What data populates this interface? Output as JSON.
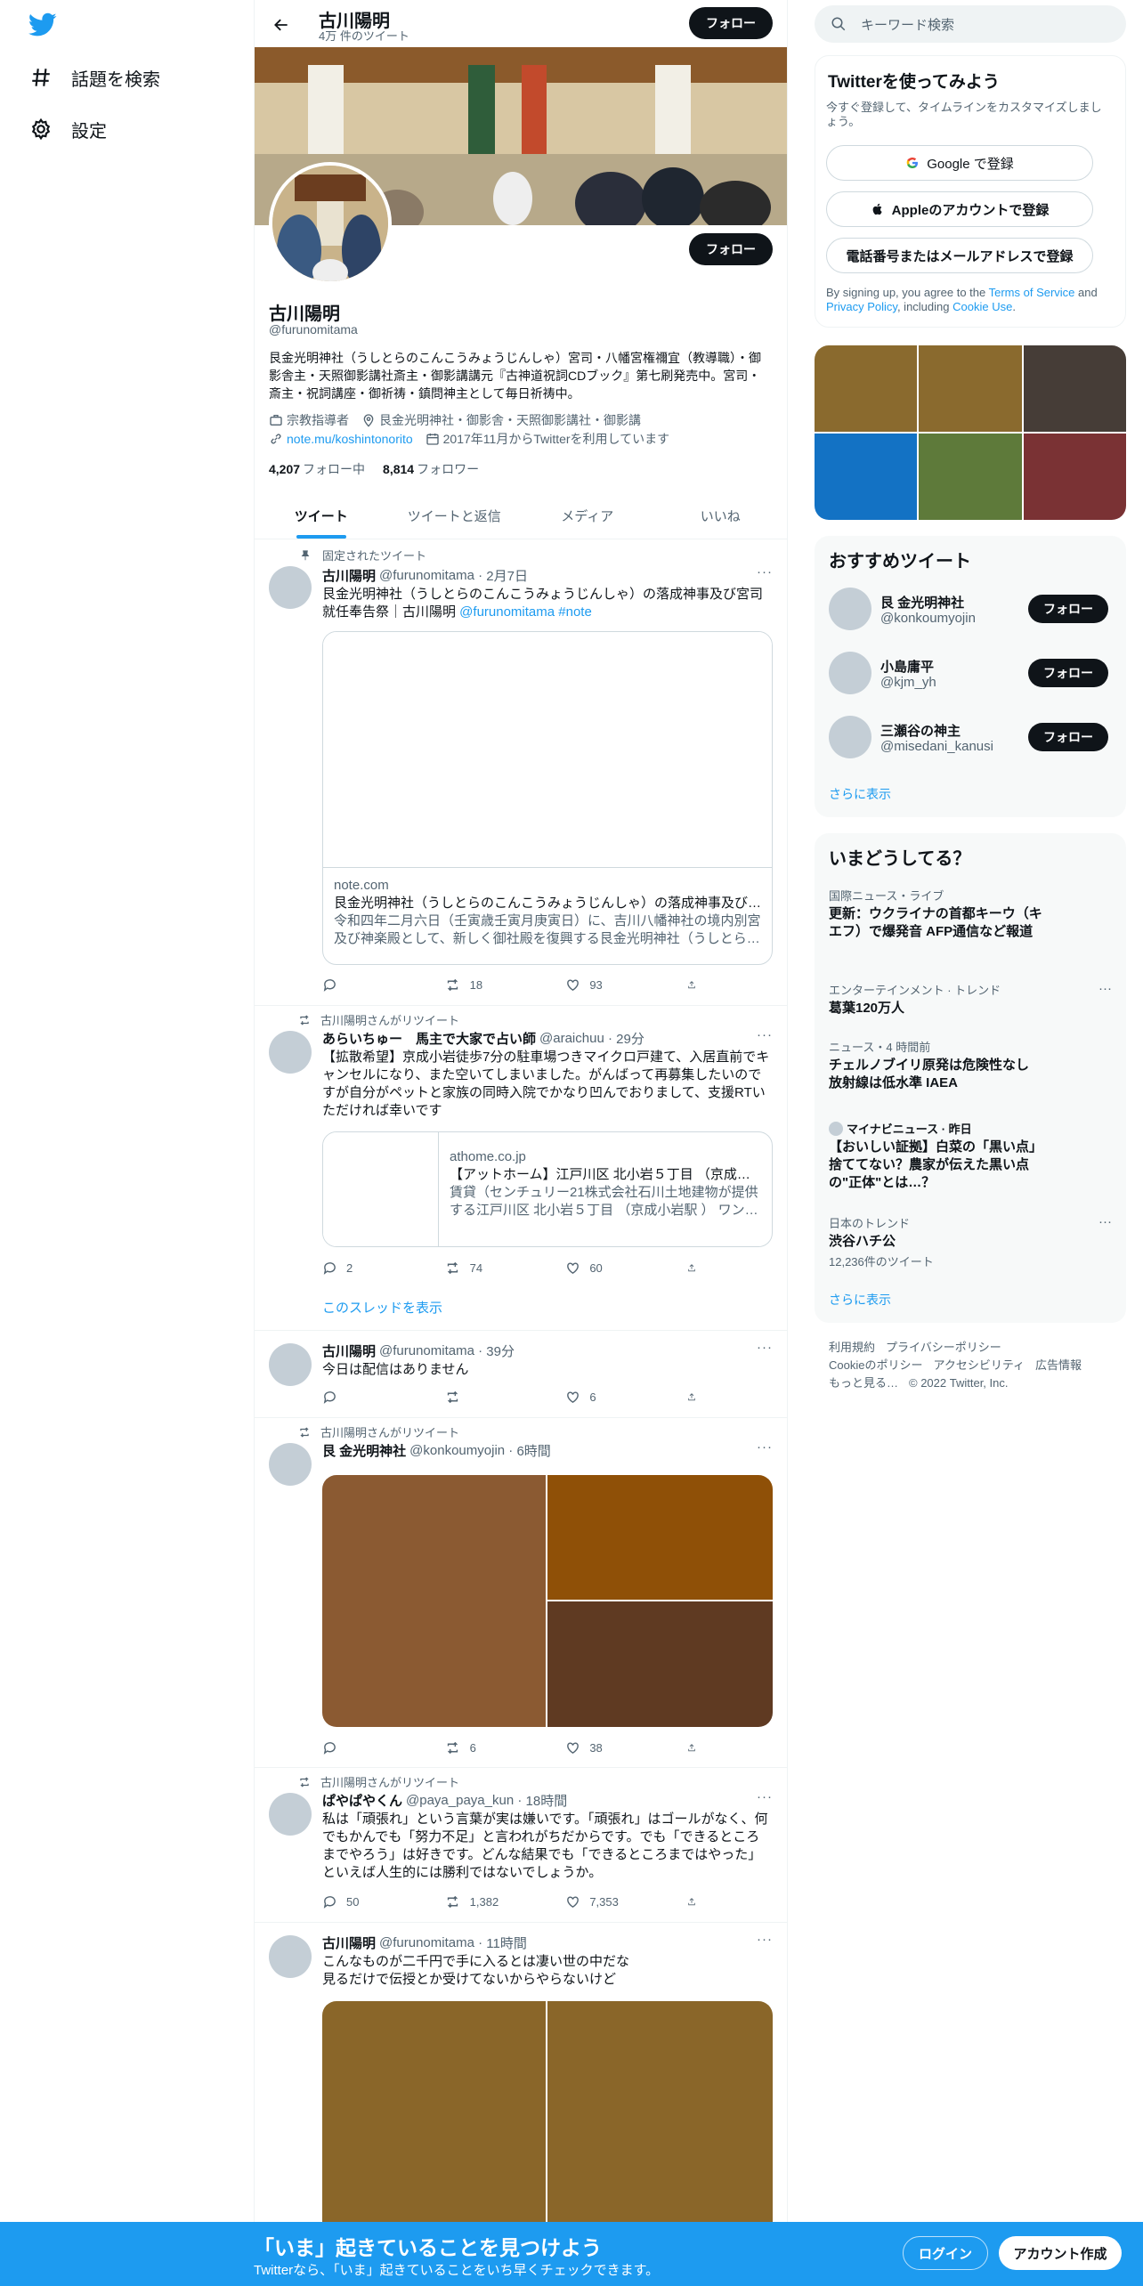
{
  "nav": {
    "items": [
      {
        "label": "話題を検索",
        "icon": "hashtag-icon"
      },
      {
        "label": "設定",
        "icon": "gear-icon"
      }
    ]
  },
  "header": {
    "name": "古川陽明",
    "tweet_count": "4万 件のツイート",
    "follow_label": "フォロー"
  },
  "profile": {
    "name": "古川陽明",
    "handle": "@furunomitama",
    "follow_label": "フォロー",
    "bio": "艮金光明神社（うしとらのこんこうみょうじんしゃ）宮司・八幡宮権禰宜（教導職）・御影舎主・天照御影講社斎主・御影講講元『古神道祝詞CDブック』第七刷発売中。宮司・斎主・祝詞講座・御祈祷・鎮問神主として毎日祈祷中。",
    "category": "宗教指導者",
    "location": "艮金光明神社・御影舎・天照御影講社・御影講",
    "website": "note.mu/koshintonorito",
    "joined": "2017年11月からTwitterを利用しています",
    "following_count": "4,207",
    "following_label": "フォロー中",
    "followers_count": "8,814",
    "followers_label": "フォロワー"
  },
  "tabs": [
    {
      "label": "ツイート",
      "active": true
    },
    {
      "label": "ツイートと返信",
      "active": false
    },
    {
      "label": "メディア",
      "active": false
    },
    {
      "label": "いいね",
      "active": false
    }
  ],
  "tweets": [
    {
      "context": "固定されたツイート",
      "name": "古川陽明",
      "handle": "@furunomitama",
      "time": "2月7日",
      "more": "···",
      "text": "艮金光明神社（うしとらのこんこうみょうじんしゃ）の落成神事及び宮司就任奉告祭｜古川陽明 ",
      "text_link": "@furunomitama #note",
      "card": {
        "domain": "note.com",
        "title": "艮金光明神社（うしとらのこんこうみょうじんしゃ）の落成神事及び…",
        "desc": "令和四年二月六日（壬寅歳壬寅月庚寅日）に、吉川八幡神社の境内別宮及び神楽殿として、新しく御社殿を復興する艮金光明神社（うしとら…"
      },
      "replies": "",
      "retweets": "18",
      "likes": "93"
    },
    {
      "context": "古川陽明さんがリツイート",
      "name": "あらいちゅー　馬主で大家で占い師",
      "handle": "@araichuu",
      "time": "29分",
      "more": "···",
      "text": "【拡散希望】京成小岩徒歩7分の駐車場つきマイクロ戸建て、入居直前でキャンセルになり、また空いてしまいました。がんばって再募集したいのですが自分がペットと家族の同時入院でかなり凹んでおりまして、支援RTいただければ幸いです",
      "card": {
        "domain": "athome.co.jp",
        "title": "【アットホーム】江戸川区 北小岩５丁目 （京成…",
        "desc": "賃貸（センチュリー21株式会社石川土地建物が提供する江戸川区 北小岩５丁目 （京成小岩駅 ） ワン…"
      },
      "replies": "2",
      "retweets": "74",
      "likes": "60",
      "thread_label": "このスレッドを表示"
    },
    {
      "context": "",
      "name": "古川陽明",
      "handle": "@furunomitama",
      "time": "39分",
      "more": "···",
      "text": "今日は配信はありません",
      "replies": "",
      "retweets": "",
      "likes": "6"
    },
    {
      "context": "古川陽明さんがリツイート",
      "name": "艮 金光明神社",
      "handle": "@konkoumyojin",
      "time": "6時間",
      "more": "···",
      "text": "",
      "replies": "",
      "retweets": "6",
      "likes": "38"
    },
    {
      "context": "古川陽明さんがリツイート",
      "name": "ぱやぱやくん",
      "handle": "@paya_paya_kun",
      "time": "18時間",
      "more": "···",
      "text": "私は「頑張れ」という言葉が実は嫌いです。「頑張れ」はゴールがなく、何でもかんでも「努力不足」と言われがちだからです。でも「できるところまでやろう」は好きです。どんな結果でも「できるところまではやった」といえば人生的には勝利ではないでしょうか。",
      "replies": "50",
      "retweets": "1,382",
      "likes": "7,353"
    },
    {
      "context": "",
      "name": "古川陽明",
      "handle": "@furunomitama",
      "time": "11時間",
      "more": "···",
      "text": "こんなものが二千円で手に入るとは凄い世の中だな\n見るだけで伝授とか受けてないからやらないけど"
    }
  ],
  "right": {
    "search_placeholder": "キーワード検索",
    "signup": {
      "title": "Twitterを使ってみよう",
      "subtitle": "今すぐ登録して、タイムラインをカスタマイズしましょう。",
      "google": "Google で登録",
      "apple": "Appleのアカウントで登録",
      "phone": "電話番号またはメールアドレスで登録",
      "terms_prefix": "By signing up, you agree to the ",
      "terms_link": "Terms of Service",
      "terms_and": " and ",
      "privacy_link": "Privacy Policy",
      "terms_including": ", including ",
      "cookie_link": "Cookie Use",
      "terms_end": "."
    },
    "media_colors": [
      "#8a6a2e",
      "#8a6a2e",
      "#463d37",
      "#1372c4",
      "#5e7a3a",
      "#7a3234"
    ],
    "recommend": {
      "title": "おすすめツイート",
      "accounts": [
        {
          "name": "艮 金光明神社",
          "handle": "@konkoumyojin",
          "follow": "フォロー"
        },
        {
          "name": "小島庸平",
          "handle": "@kjm_yh",
          "follow": "フォロー"
        },
        {
          "name": "三瀬谷の神主",
          "handle": "@misedani_kanusi",
          "follow": "フォロー"
        }
      ],
      "show_more": "さらに表示"
    },
    "trends": {
      "title": "いまどうしてる？",
      "items": [
        {
          "category": "国際ニュース・ライブ",
          "name": "更新：ウクライナの首都キーウ（キエフ）で爆発音 AFP通信など報道",
          "count": ""
        },
        {
          "category": "エンターテインメント · トレンド",
          "name": "葛葉120万人",
          "count": ""
        },
        {
          "category": "ニュース・4 時間前",
          "name": "チェルノブイリ原発は危険性なし 放射線は低水準 IAEA",
          "count": ""
        },
        {
          "category": "マイナビニュース · 昨日",
          "name": "【おいしい証拠】白菜の「黒い点」捨ててない？農家が伝えた黒い点の\"正体\"とは…？",
          "count": ""
        },
        {
          "category": "日本のトレンド",
          "name": "渋谷ハチ公",
          "count": "12,236件のツイート"
        }
      ],
      "show_more": "さらに表示"
    },
    "footer": {
      "line1": [
        "利用規約",
        "プライバシーポリシー"
      ],
      "line2": [
        "Cookieのポリシー",
        "アクセシビリティ",
        "広告情報"
      ],
      "line3": [
        "もっと見る…",
        "© 2022 Twitter, Inc."
      ]
    }
  },
  "bottom": {
    "title": "「いま」起きていることを見つけよう",
    "subtitle": "Twitterなら、「いま」起きていることをいち早くチェックできます。",
    "login": "ログイン",
    "signup": "アカウント作成"
  },
  "colors": {
    "accent": "#1d9bf0",
    "text": "#0f1419",
    "muted": "#536471"
  }
}
